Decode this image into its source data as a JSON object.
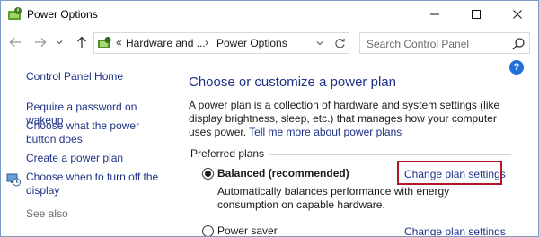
{
  "window": {
    "title": "Power Options",
    "icons": {
      "app": "power-options-icon",
      "minimize": "minimize-icon",
      "maximize": "maximize-icon",
      "close": "close-icon"
    }
  },
  "navigation": {
    "icons": {
      "back": "back-arrow-icon",
      "forward": "forward-arrow-icon",
      "recent": "chevron-down-icon",
      "up": "up-arrow-icon"
    },
    "address": {
      "icon": "control-panel-icon",
      "overflow_chevron": "«",
      "segments": [
        "Hardware and ...",
        "Power Options"
      ],
      "separator": "›",
      "icons": {
        "dropdown": "chevron-down-icon",
        "refresh": "refresh-icon"
      }
    },
    "search": {
      "placeholder": "Search Control Panel",
      "icon": "search-icon"
    }
  },
  "sidebar": {
    "home_link": "Control Panel Home",
    "links": [
      "Require a password on wakeup",
      "Choose what the power button does",
      "Create a power plan",
      "Choose when to turn off the display"
    ],
    "turn_off_icon": "monitor-clock-icon",
    "see_also": "See also"
  },
  "main": {
    "help_icon": "?",
    "heading": "Choose or customize a power plan",
    "description": "A power plan is a collection of hardware and system settings (like display brightness, sleep, etc.) that manages how your computer uses power.",
    "description_link": "Tell me more about power plans",
    "preferred_plans_label": "Preferred plans",
    "plans": [
      {
        "name": "Balanced (recommended)",
        "selected": true,
        "description": "Automatically balances performance with energy consumption on capable hardware.",
        "change_link": "Change plan settings"
      },
      {
        "name": "Power saver",
        "selected": false,
        "change_link": "Change plan settings"
      }
    ],
    "highlight_color": "#b3152b",
    "link_color": "#1e3287"
  }
}
